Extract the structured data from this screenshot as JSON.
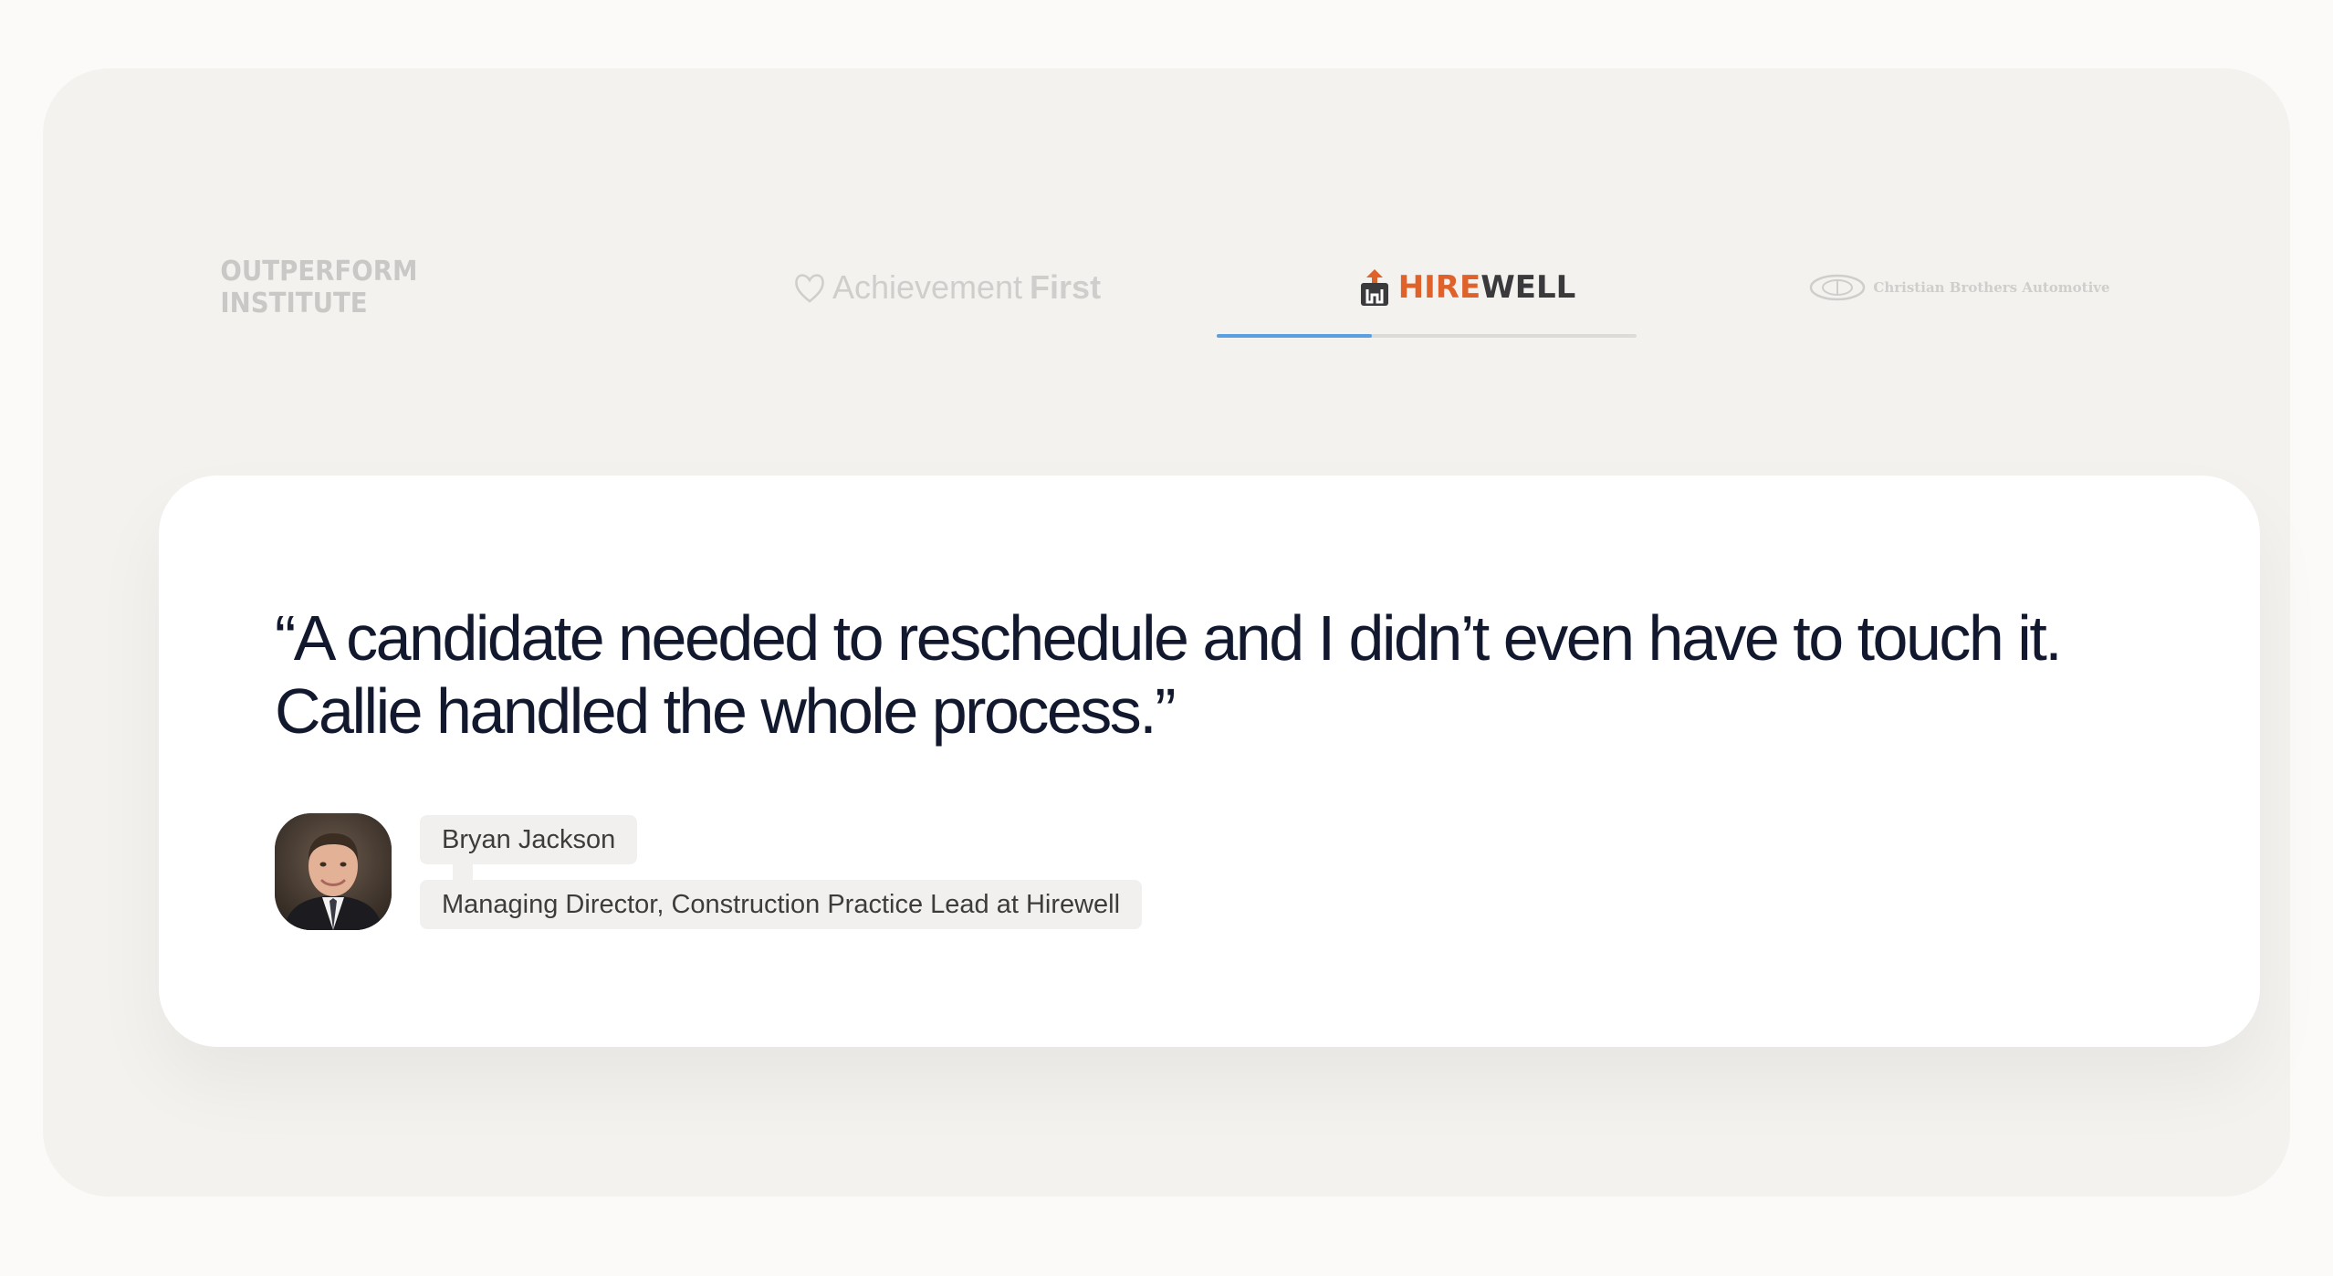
{
  "logos": [
    {
      "name": "OUTPERFORM INSTITUTE",
      "active": false
    },
    {
      "name_primary": "Achievement",
      "name_secondary": "First",
      "active": false
    },
    {
      "name_primary": "HIRE",
      "name_secondary": "WELL",
      "active": true
    },
    {
      "name": "Christian Brothers Automotive",
      "active": false
    }
  ],
  "progress": {
    "active_index": 2,
    "fill_fraction": 0.37
  },
  "colors": {
    "accent": "#5a9fe0",
    "hirewell_orange": "#e0622b",
    "quote_text": "#12192e",
    "panel_bg": "#f3f2ef",
    "card_bg": "#ffffff"
  },
  "testimonial": {
    "quote_line1": "“A candidate needed to reschedule and I didn’t even have to touch it.",
    "quote_line2": "Callie handled the whole process.”",
    "author_name": "Bryan Jackson",
    "author_title": "Managing Director, Construction Practice Lead at Hirewell"
  }
}
